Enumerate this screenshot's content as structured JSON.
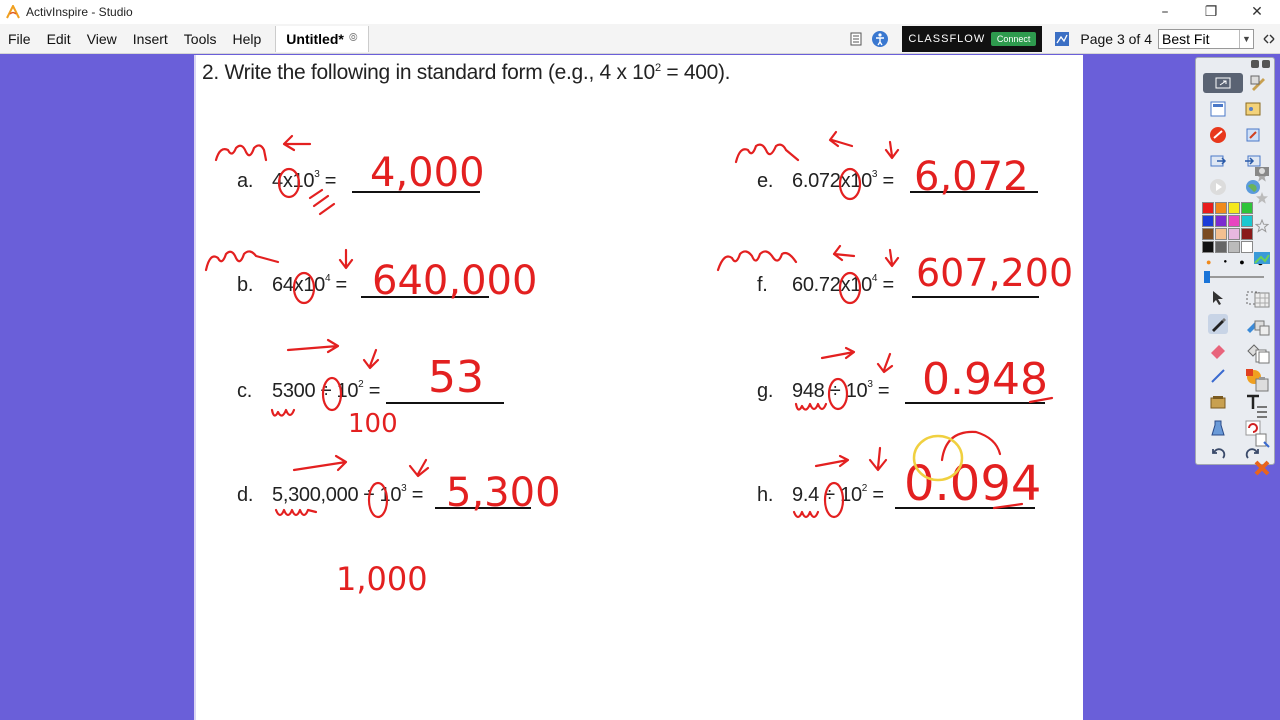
{
  "window": {
    "title": "ActivInspire - Studio"
  },
  "menu": {
    "items": [
      "File",
      "Edit",
      "View",
      "Insert",
      "Tools",
      "Help"
    ]
  },
  "doc_tab": {
    "label": "Untitled*"
  },
  "classflow": {
    "brand": "CLASSFLOW",
    "connect_label": "Connect"
  },
  "pager": {
    "label": "Page 3 of 4",
    "current": 3,
    "total": 4
  },
  "zoom": {
    "selected": "Best Fit"
  },
  "worksheet": {
    "question_prefix": "2.  Write the following in standard form (e.g., 4 x 10",
    "question_exp": "2",
    "question_suffix": " = 400).",
    "problems": [
      {
        "letter": "a.",
        "base": "4",
        "op": "x",
        "exp": "3"
      },
      {
        "letter": "b.",
        "base": "64",
        "op": "x",
        "exp": "4"
      },
      {
        "letter": "c.",
        "base": "5300",
        "op": "÷",
        "exp": "2"
      },
      {
        "letter": "d.",
        "base": "5,300,000",
        "op": "÷",
        "exp": "3"
      },
      {
        "letter": "e.",
        "base": "6.072",
        "op": "x",
        "exp": "3"
      },
      {
        "letter": "f.",
        "base": "60.72",
        "op": "x",
        "exp": "4"
      },
      {
        "letter": "g.",
        "base": "948",
        "op": "÷",
        "exp": "3"
      },
      {
        "letter": "h.",
        "base": "9.4",
        "op": "÷",
        "exp": "2"
      }
    ],
    "ten": "10",
    "equals": "="
  },
  "annotations": {
    "answers": [
      "4,000",
      "640,000",
      "53",
      "5,300",
      "6,072",
      "607,200",
      "0.948",
      "0.094"
    ],
    "notes": [
      "100",
      "1,000"
    ],
    "ink_color": "#e32020"
  },
  "colors": {
    "desktop": "#6a5fd9",
    "accent": "#1a74d8"
  }
}
